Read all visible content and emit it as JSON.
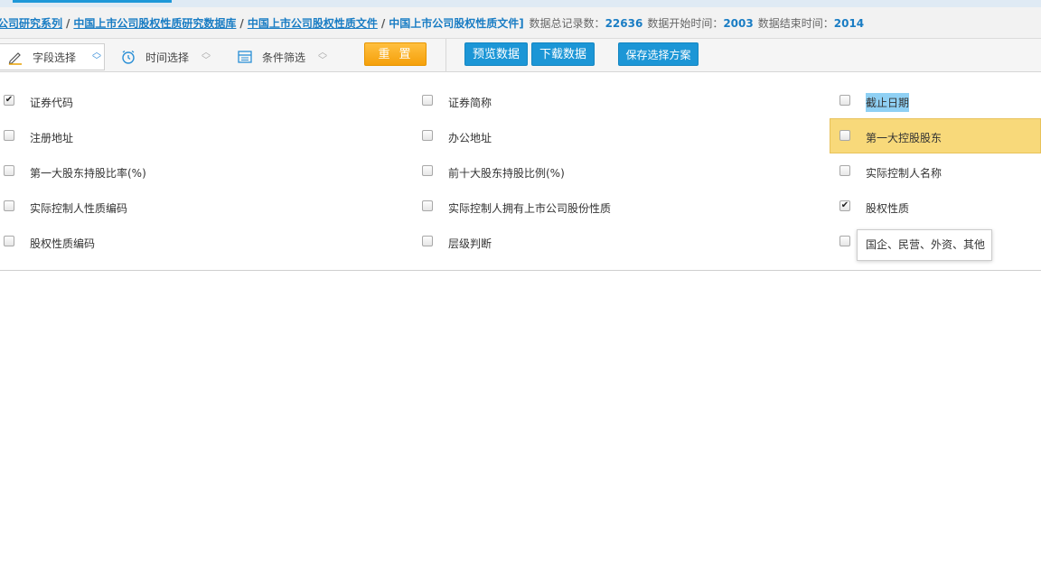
{
  "breadcrumb": {
    "items": [
      "公司研究系列",
      "中国上市公司股权性质研究数据库",
      "中国上市公司股权性质文件"
    ],
    "current": "中国上市公司股权性质文件]",
    "separator": "/"
  },
  "stats": {
    "total_label": "数据总记录数：",
    "total_value": "22636",
    "start_label": "数据开始时间：",
    "start_value": "2003",
    "end_label": "数据结束时间：",
    "end_value": "2014"
  },
  "toolbar": {
    "field_select": "字段选择",
    "time_select": "时间选择",
    "condition_filter": "条件筛选",
    "reset": "重置",
    "preview": "预览数据",
    "download": "下载数据",
    "save_plan": "保存选择方案"
  },
  "fields": {
    "col1": [
      {
        "label": "证券代码",
        "checked": true
      },
      {
        "label": "注册地址",
        "checked": false
      },
      {
        "label": "第一大股东持股比率(%)",
        "checked": false
      },
      {
        "label": "实际控制人性质编码",
        "checked": false
      },
      {
        "label": "股权性质编码",
        "checked": false
      }
    ],
    "col2": [
      {
        "label": "证券简称",
        "checked": false
      },
      {
        "label": "办公地址",
        "checked": false
      },
      {
        "label": "前十大股东持股比例(%)",
        "checked": false
      },
      {
        "label": "实际控制人拥有上市公司股份性质",
        "checked": false
      },
      {
        "label": "层级判断",
        "checked": false
      }
    ],
    "col3": [
      {
        "label": "截止日期",
        "checked": false
      },
      {
        "label": "第一大控股股东",
        "checked": false
      },
      {
        "label": "实际控制人名称",
        "checked": false
      },
      {
        "label": "股权性质",
        "checked": true
      }
    ]
  },
  "tooltip": "国企、民营、外资、其他",
  "colors": {
    "link": "#1a7dc4",
    "button_blue": "#1c96d6",
    "button_orange": "#f5a00a",
    "row_highlight": "#f8d97a",
    "text_selection": "#8fd0f4"
  }
}
